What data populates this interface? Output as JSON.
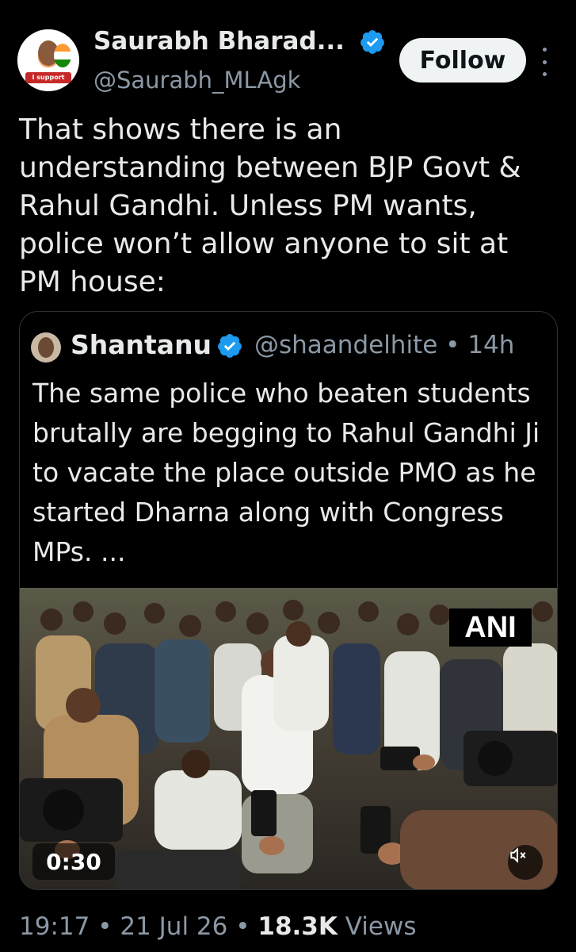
{
  "author": {
    "name": "Saurabh Bharad...",
    "handle": "@Saurabh_MLAgk",
    "avatar_badge": "I support Sonam"
  },
  "follow_label": "Follow",
  "tweet": {
    "text": "That shows there is an understanding between BJP Govt & Rahul Gandhi. Unless PM wants, police won’t allow anyone to sit at PM house:"
  },
  "quoted": {
    "name": "Shantanu",
    "handle": "@shaandelhite",
    "sep": "•",
    "age": "14h",
    "text": "The same police who beaten students brutally are begging to Rahul Gandhi Ji to vacate the place outside PMO as he started Dharna along with Congress MPs. ...",
    "video": {
      "watermark": "ANI",
      "duration": "0:30",
      "muted": true
    }
  },
  "meta": {
    "time": "19:17",
    "sep1": "•",
    "date": "21 Jul 26",
    "sep2": "•",
    "views_count": "18.3K",
    "views_label": "Views"
  },
  "colors": {
    "background": "#000000",
    "text_primary": "#e7e9ea",
    "text_secondary": "#8b98a5",
    "verified": "#1d9bf0",
    "border": "#2f3336"
  }
}
